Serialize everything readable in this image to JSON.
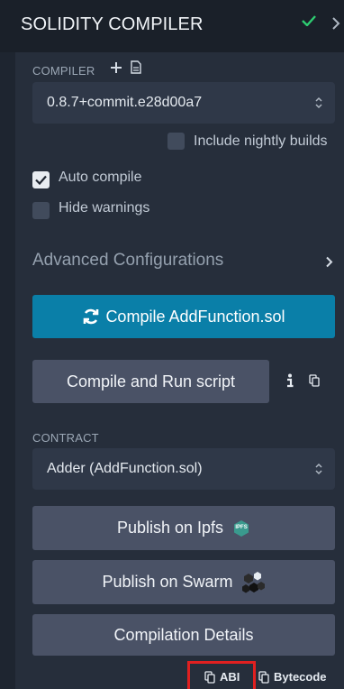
{
  "header": {
    "title": "SOLIDITY COMPILER",
    "status_icon": "check-icon",
    "expand_icon": "chevron-right-icon",
    "status_color": "#2ecc71"
  },
  "compiler": {
    "label": "COMPILER",
    "add_icon": "plus-icon",
    "file_icon": "file-icon",
    "version": "0.8.7+commit.e28d00a7",
    "include_nightly_label": "Include nightly builds",
    "include_nightly_checked": false,
    "auto_compile_label": "Auto compile",
    "auto_compile_checked": true,
    "hide_warnings_label": "Hide warnings",
    "hide_warnings_checked": false
  },
  "advanced": {
    "label": "Advanced Configurations",
    "chevron_icon": "chevron-right-icon"
  },
  "actions": {
    "compile_icon": "refresh-icon",
    "compile_label": "Compile AddFunction.sol",
    "compile_run_label": "Compile and Run script",
    "info_icon": "info-icon",
    "copy_icon": "copy-icon"
  },
  "contract": {
    "label": "CONTRACT",
    "selected": "Adder (AddFunction.sol)"
  },
  "publish": {
    "ipfs_label": "Publish on Ipfs",
    "ipfs_badge": "IPFS",
    "swarm_label": "Publish on Swarm",
    "swarm_icon": "swarm-icon",
    "details_label": "Compilation Details"
  },
  "footer": {
    "abi_label": "ABI",
    "bytecode_label": "Bytecode"
  },
  "colors": {
    "accent": "#0a7fa8",
    "highlight": "#e02020"
  }
}
